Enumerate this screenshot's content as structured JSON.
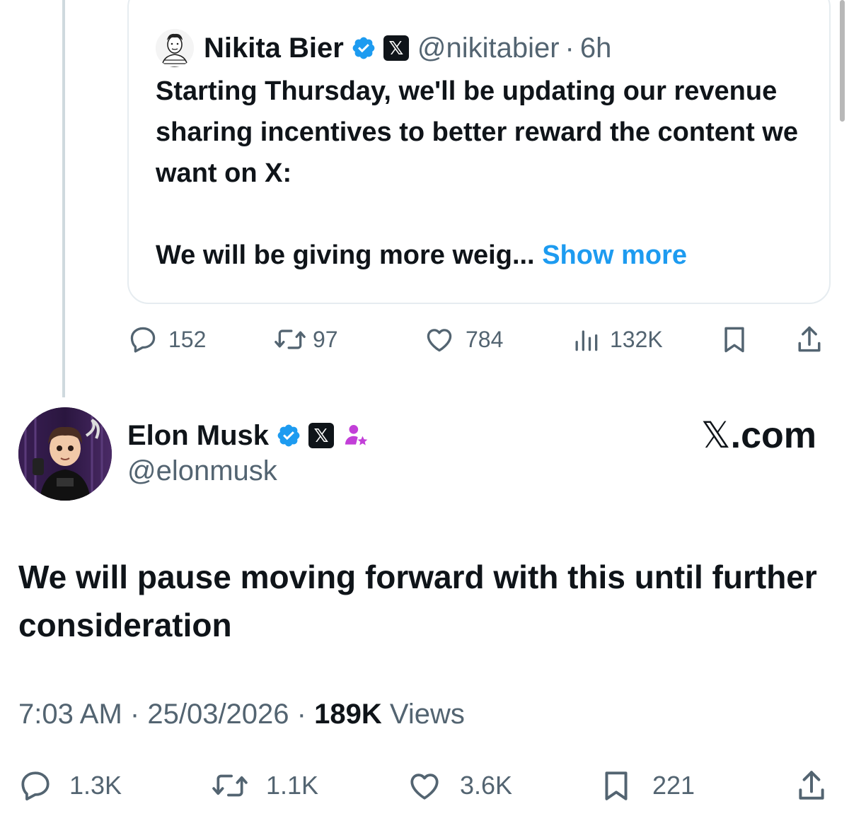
{
  "quoted_tweet": {
    "author_name": "Nikita Bier",
    "handle": "@nikitabier",
    "separator": "·",
    "time": "6h",
    "text_line1": "Starting Thursday, we'll be updating our revenue sharing incentives to better reward the content we want on X:",
    "text_line2": "We will be giving more weig...",
    "show_more": "Show more",
    "stats": {
      "replies": "152",
      "reposts": "97",
      "likes": "784",
      "views": "132K"
    }
  },
  "main_tweet": {
    "author_name": "Elon Musk",
    "handle": "@elonmusk",
    "source_label": ".com",
    "text": "We will pause moving forward with this until further consideration",
    "time": "7:03 AM",
    "date": "25/03/2026",
    "separator": "·",
    "views_count": "189K",
    "views_label": "Views",
    "stats": {
      "replies": "1.3K",
      "reposts": "1.1K",
      "likes": "3.6K",
      "bookmarks": "221"
    }
  },
  "colors": {
    "accent": "#1d9bf0",
    "verified": "#1d9bf0",
    "text": "#0f1419",
    "muted": "#536471",
    "affiliate": "#c23fd8"
  },
  "icons": [
    "verified-badge-icon",
    "x-logo-icon",
    "reply-icon",
    "repost-icon",
    "like-icon",
    "views-icon",
    "bookmark-icon",
    "share-icon",
    "affiliate-icon"
  ]
}
